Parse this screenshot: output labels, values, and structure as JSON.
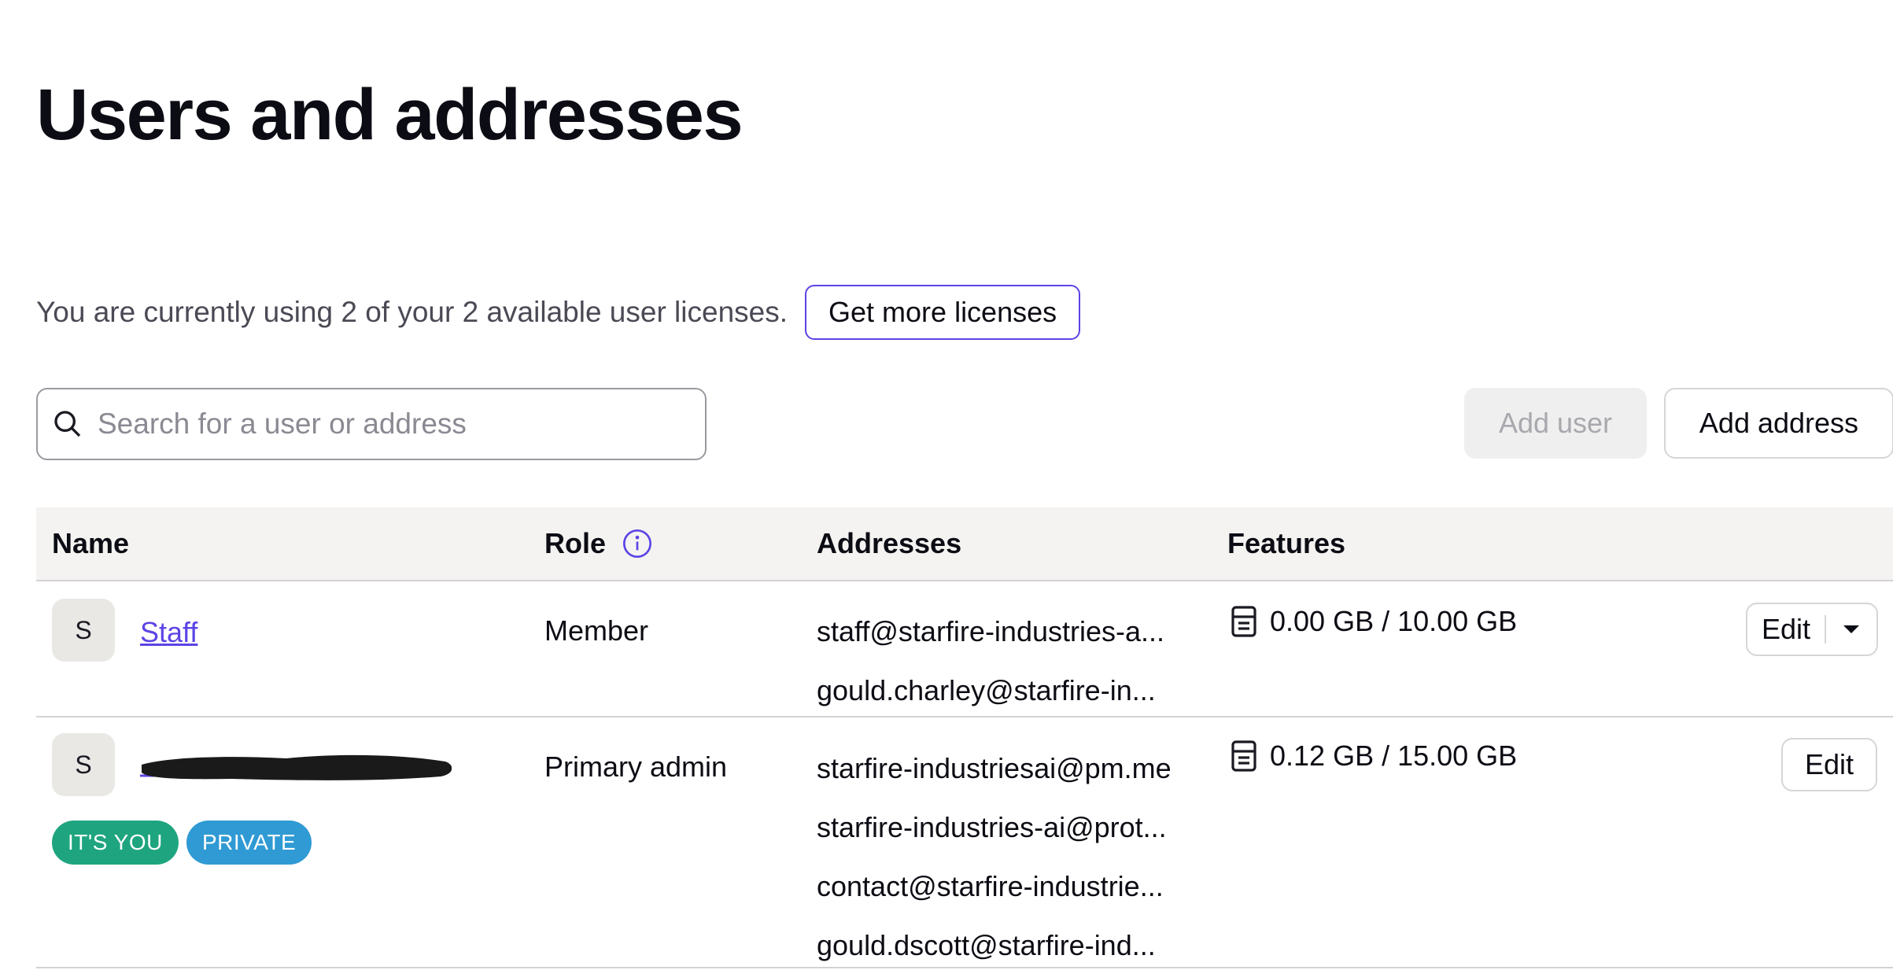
{
  "page": {
    "title": "Users and addresses"
  },
  "licenses": {
    "text": "You are currently using 2 of your 2 available user licenses.",
    "button": "Get more licenses"
  },
  "search": {
    "placeholder": "Search for a user or address",
    "value": ""
  },
  "actions": {
    "add_user": "Add user",
    "add_address": "Add address"
  },
  "table": {
    "headers": {
      "name": "Name",
      "role": "Role",
      "addresses": "Addresses",
      "features": "Features"
    },
    "rows": [
      {
        "avatar": "S",
        "name": "Staff",
        "role": "Member",
        "addresses": [
          "staff@starfire-industries-a...",
          "gould.charley@starfire-in..."
        ],
        "storage": "0.00 GB / 10.00 GB",
        "action": "Edit"
      },
      {
        "avatar": "S",
        "name": "",
        "badges": [
          "IT'S YOU",
          "PRIVATE"
        ],
        "role": "Primary admin",
        "addresses": [
          "starfire-industriesai@pm.me",
          "starfire-industries-ai@prot...",
          "contact@starfire-industrie...",
          "gould.dscott@starfire-ind..."
        ],
        "storage": "0.12 GB / 15.00 GB",
        "action": "Edit"
      }
    ]
  },
  "colors": {
    "accent": "#5b44e6",
    "badge_you": "#1ea57f",
    "badge_private": "#2f9ad3",
    "header_bg": "#f4f3f1"
  }
}
